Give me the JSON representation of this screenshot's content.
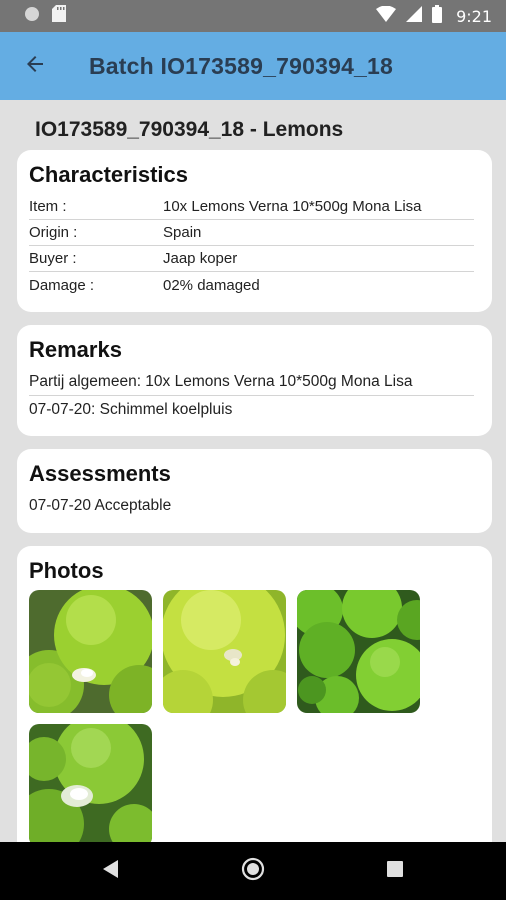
{
  "status_bar": {
    "time": "9:21",
    "icons": [
      "circle-notification-icon",
      "sd-card-icon",
      "wifi-icon",
      "cell-signal-icon",
      "battery-icon"
    ]
  },
  "app_bar": {
    "title": "Batch IO173589_790394_18",
    "back_icon": "arrow-left-icon",
    "background": "#64ade3"
  },
  "page": {
    "heading": "IO173589_790394_18 - Lemons"
  },
  "characteristics": {
    "title": "Characteristics",
    "rows": [
      {
        "label": "Item :",
        "value": "10x Lemons Verna 10*500g Mona Lisa"
      },
      {
        "label": "Origin :",
        "value": "Spain"
      },
      {
        "label": "Buyer :",
        "value": "Jaap koper"
      },
      {
        "label": "Damage :",
        "value": "02% damaged"
      }
    ]
  },
  "remarks": {
    "title": "Remarks",
    "items": [
      "Partij algemeen: 10x Lemons Verna 10*500g Mona Lisa",
      "07-07-20: Schimmel koelpluis"
    ]
  },
  "assessments": {
    "title": "Assessments",
    "items": [
      "07-07-20 Acceptable"
    ]
  },
  "photos": {
    "title": "Photos",
    "count": 4
  },
  "nav_bar": {
    "icons": [
      "back-triangle-icon",
      "home-circle-icon",
      "recents-square-icon"
    ]
  }
}
